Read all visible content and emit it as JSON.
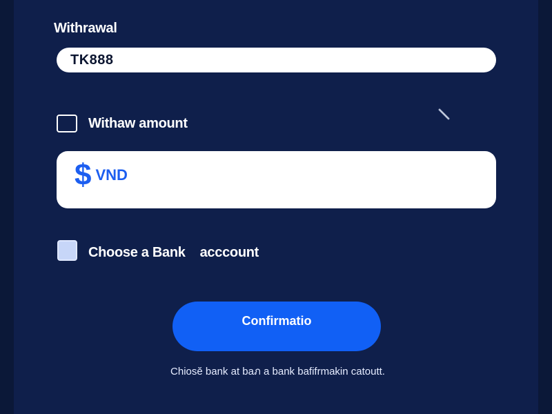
{
  "form": {
    "title": "Withrawal",
    "account_value": "TK888",
    "amount_label": "Withaw amount",
    "amount_currency": "VND",
    "amount_icon": "dollar-icon",
    "bank_label": "Choose a Bank    acccount",
    "confirm_label": "Confirmatio",
    "footnote": "Chiosĕ bank at baภ a bank bafifrmakin catoutt."
  },
  "colors": {
    "background": "#0f1f4b",
    "accent": "#1160f5",
    "field": "#ffffff"
  }
}
